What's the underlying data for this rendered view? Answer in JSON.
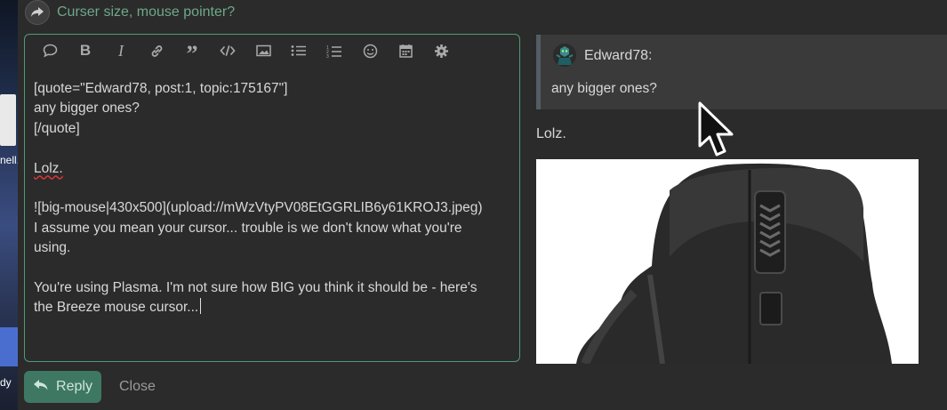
{
  "desktop": {
    "labels": [
      "nell.",
      "dy"
    ]
  },
  "reply_to": {
    "icon": "share-arrow-icon",
    "title": "Curser size, mouse pointer?"
  },
  "toolbar": {
    "icons": [
      "quote-bubble-icon",
      "bold-icon",
      "italic-icon",
      "link-icon",
      "blockquote-icon",
      "code-icon",
      "image-icon",
      "bullet-list-icon",
      "numbered-list-icon",
      "emoji-icon",
      "calendar-icon",
      "gear-icon"
    ]
  },
  "editor": {
    "lines": [
      "[quote=\"Edward78, post:1, topic:175167\"]",
      "any bigger ones?",
      "[/quote]",
      "",
      "Lolz.",
      "",
      "![big-mouse|430x500](upload://mWzVtyPV08EtGGRLIB6y61KROJ3.jpeg)",
      "I assume you mean your cursor... trouble is we don't know what you're",
      "using.",
      "",
      "You're using Plasma. I'm not sure how BIG you think it should be - here's",
      "the Breeze mouse cursor..."
    ]
  },
  "buttons": {
    "reply": "Reply",
    "close": "Close"
  },
  "preview": {
    "quote_user": "Edward78:",
    "quote_text": "any bigger ones?",
    "body": "Lolz."
  },
  "colors": {
    "accent": "#4f9a78",
    "reply_button": "#3e7862",
    "title": "#6fa88a"
  }
}
